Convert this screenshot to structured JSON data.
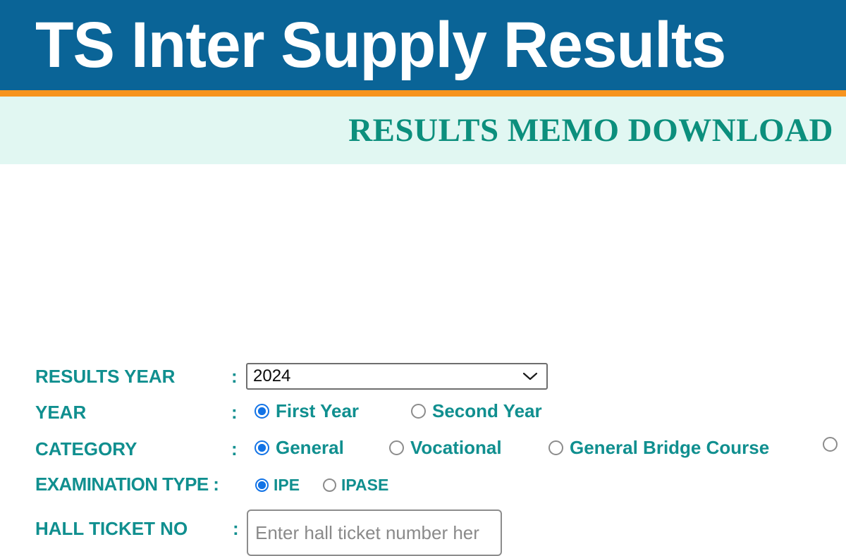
{
  "banner": {
    "title": "TS Inter Supply Results",
    "bg_color": "#0a6497",
    "accent_color": "#f7941e",
    "text_color": "#ffffff"
  },
  "memo_band": {
    "title": "RESULTS MEMO DOWNLOAD",
    "bg_color": "#e1f7f2",
    "text_color": "#0c8f7d"
  },
  "form": {
    "label_color": "#108f8f",
    "selected_radio_color": "#1273e6",
    "separator": ":",
    "rows": {
      "results_year": {
        "label": "RESULTS YEAR",
        "separator": ":",
        "select": {
          "value": "2024",
          "icon": "chevron-down-icon"
        }
      },
      "year": {
        "label": "YEAR",
        "separator": ":",
        "options": [
          {
            "label": "First Year",
            "selected": true
          },
          {
            "label": "Second Year",
            "selected": false
          }
        ]
      },
      "category": {
        "label": "CATEGORY",
        "separator": ":",
        "options": [
          {
            "label": "General",
            "selected": true
          },
          {
            "label": "Vocational",
            "selected": false
          },
          {
            "label": "General Bridge Course",
            "selected": false
          },
          {
            "label": "",
            "selected": false
          }
        ]
      },
      "examination_type": {
        "label": "EXAMINATION TYPE :",
        "options": [
          {
            "label": "IPE",
            "selected": true
          },
          {
            "label": "IPASE",
            "selected": false
          }
        ]
      },
      "hall_ticket_no": {
        "label": "HALL TICKET NO",
        "separator": ":",
        "value": "",
        "placeholder": "Enter hall ticket number her"
      }
    }
  }
}
